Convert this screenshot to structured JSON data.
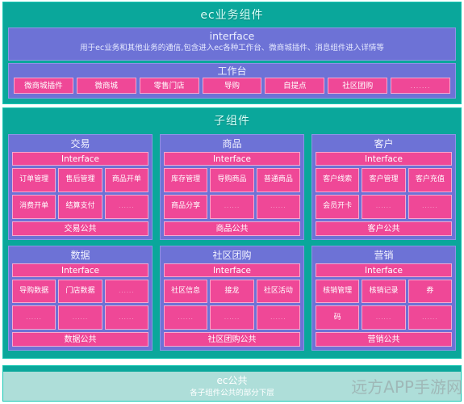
{
  "top": {
    "title": "ec业务组件",
    "interface": {
      "title": "interface",
      "description": "用于ec业务和其他业务的通信,包含进入ec各种工作台、微商城插件、消息组件进入详情等"
    },
    "workbench": {
      "title": "工作台",
      "chips": [
        "微商城插件",
        "微商城",
        "零售门店",
        "导购",
        "自提点",
        "社区团购",
        "......."
      ]
    }
  },
  "sub": {
    "title": "子组件",
    "interface_label": "Interface",
    "cards": [
      {
        "title": "交易",
        "interface": "Interface",
        "features": [
          "订单管理",
          "售后管理",
          "商品开单",
          "消费开单",
          "结算支付",
          "......"
        ],
        "common": "交易公共"
      },
      {
        "title": "商品",
        "interface": "Interface",
        "features": [
          "库存管理",
          "导购商品",
          "普通商品",
          "商品分享",
          "......",
          "......"
        ],
        "common": "商品公共"
      },
      {
        "title": "客户",
        "interface": "Interface",
        "features": [
          "客户线索",
          "客户管理",
          "客户充值",
          "会员开卡",
          "......",
          "......"
        ],
        "common": "客户公共"
      },
      {
        "title": "数据",
        "interface": "Interface",
        "features": [
          "导购数据",
          "门店数据",
          "......",
          "......",
          "......",
          "......"
        ],
        "common": "数据公共"
      },
      {
        "title": "社区团购",
        "interface": "Interface",
        "features": [
          "社区信息",
          "接龙",
          "社区活动",
          "......",
          "......",
          "......"
        ],
        "common": "社区团购公共"
      },
      {
        "title": "营销",
        "interface": "Interface",
        "features": [
          "核销管理",
          "核销记录",
          "券",
          "码",
          "......",
          "......"
        ],
        "common": "营销公共"
      }
    ]
  },
  "bottom": {
    "title": "ec公共",
    "subtitle": "各子组件公共的部分下层"
  },
  "watermark": "远方APP手游网",
  "colors": {
    "teal": "#0aa79b",
    "teal_light": "#aeded9",
    "purple": "#6d72d6",
    "pink": "#ef4897"
  }
}
